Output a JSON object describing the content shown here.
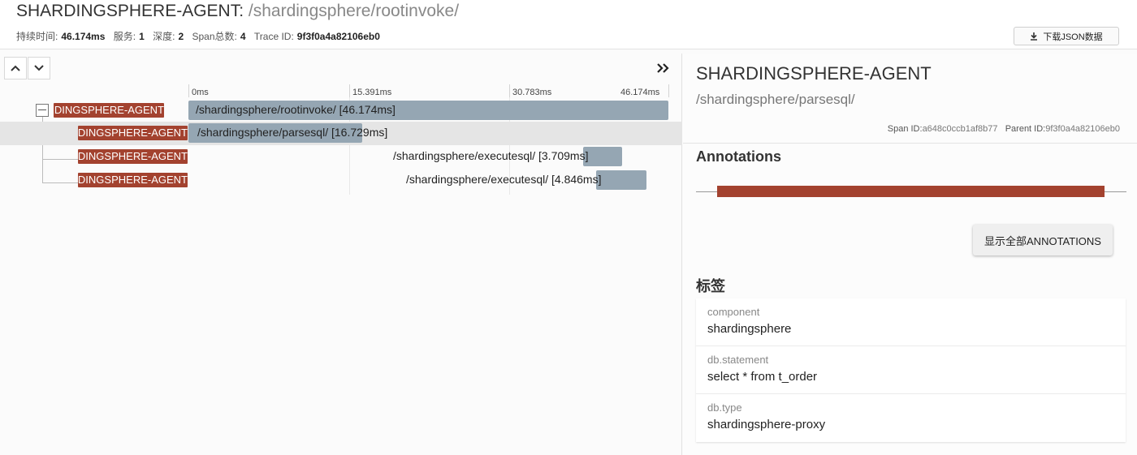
{
  "header": {
    "service": "SHARDINGSPHERE-AGENT",
    "separator": ": ",
    "path": "/shardingsphere/rootinvoke/",
    "meta": [
      {
        "label": "持续时间:",
        "value": "46.174ms"
      },
      {
        "label": "服务:",
        "value": "1"
      },
      {
        "label": "深度:",
        "value": "2"
      },
      {
        "label": "Span总数:",
        "value": "4"
      },
      {
        "label": "Trace ID:",
        "value": "9f3f0a4a82106eb0"
      }
    ],
    "download_label": "下载JSON数据"
  },
  "timeline": {
    "ticks": [
      "0ms",
      "15.391ms",
      "30.783ms",
      "46.174ms"
    ],
    "total_ms": 46.174,
    "rows": [
      {
        "service": "SHARDINGSPHERE-AGENT",
        "label": "/shardingsphere/rootinvoke/ [46.174ms]",
        "start_ms": 0,
        "duration_ms": 46.174
      },
      {
        "service": "SHARDINGSPHERE-AGENT",
        "label": "/shardingsphere/parsesql/ [16.729ms]",
        "start_ms": 0,
        "duration_ms": 16.729,
        "selected": true
      },
      {
        "service": "SHARDINGSPHERE-AGENT",
        "label": "/shardingsphere/executesql/ [3.709ms]",
        "start_ms": 38.0,
        "duration_ms": 3.709
      },
      {
        "service": "SHARDINGSPHERE-AGENT",
        "label": "/shardingsphere/executesql/ [4.846ms]",
        "start_ms": 39.2,
        "duration_ms": 4.846
      }
    ]
  },
  "detail": {
    "service": "SHARDINGSPHERE-AGENT",
    "path": "/shardingsphere/parsesql/",
    "span_id_label": "Span ID:",
    "span_id": "a648c0ccb1af8b77",
    "parent_id_label": "Parent ID:",
    "parent_id": "9f3f0a4a82106eb0",
    "annotations_title": "Annotations",
    "show_all_label": "显示全部ANNOTATIONS",
    "tags_title": "标签",
    "tags": [
      {
        "key": "component",
        "value": "shardingsphere"
      },
      {
        "key": "db.statement",
        "value": "select * from t_order"
      },
      {
        "key": "db.type",
        "value": "shardingsphere-proxy"
      }
    ]
  },
  "colors": {
    "service_badge": "#a3422f",
    "span_bar": "#95a6b3",
    "selected_row": "#e5e5e5"
  }
}
